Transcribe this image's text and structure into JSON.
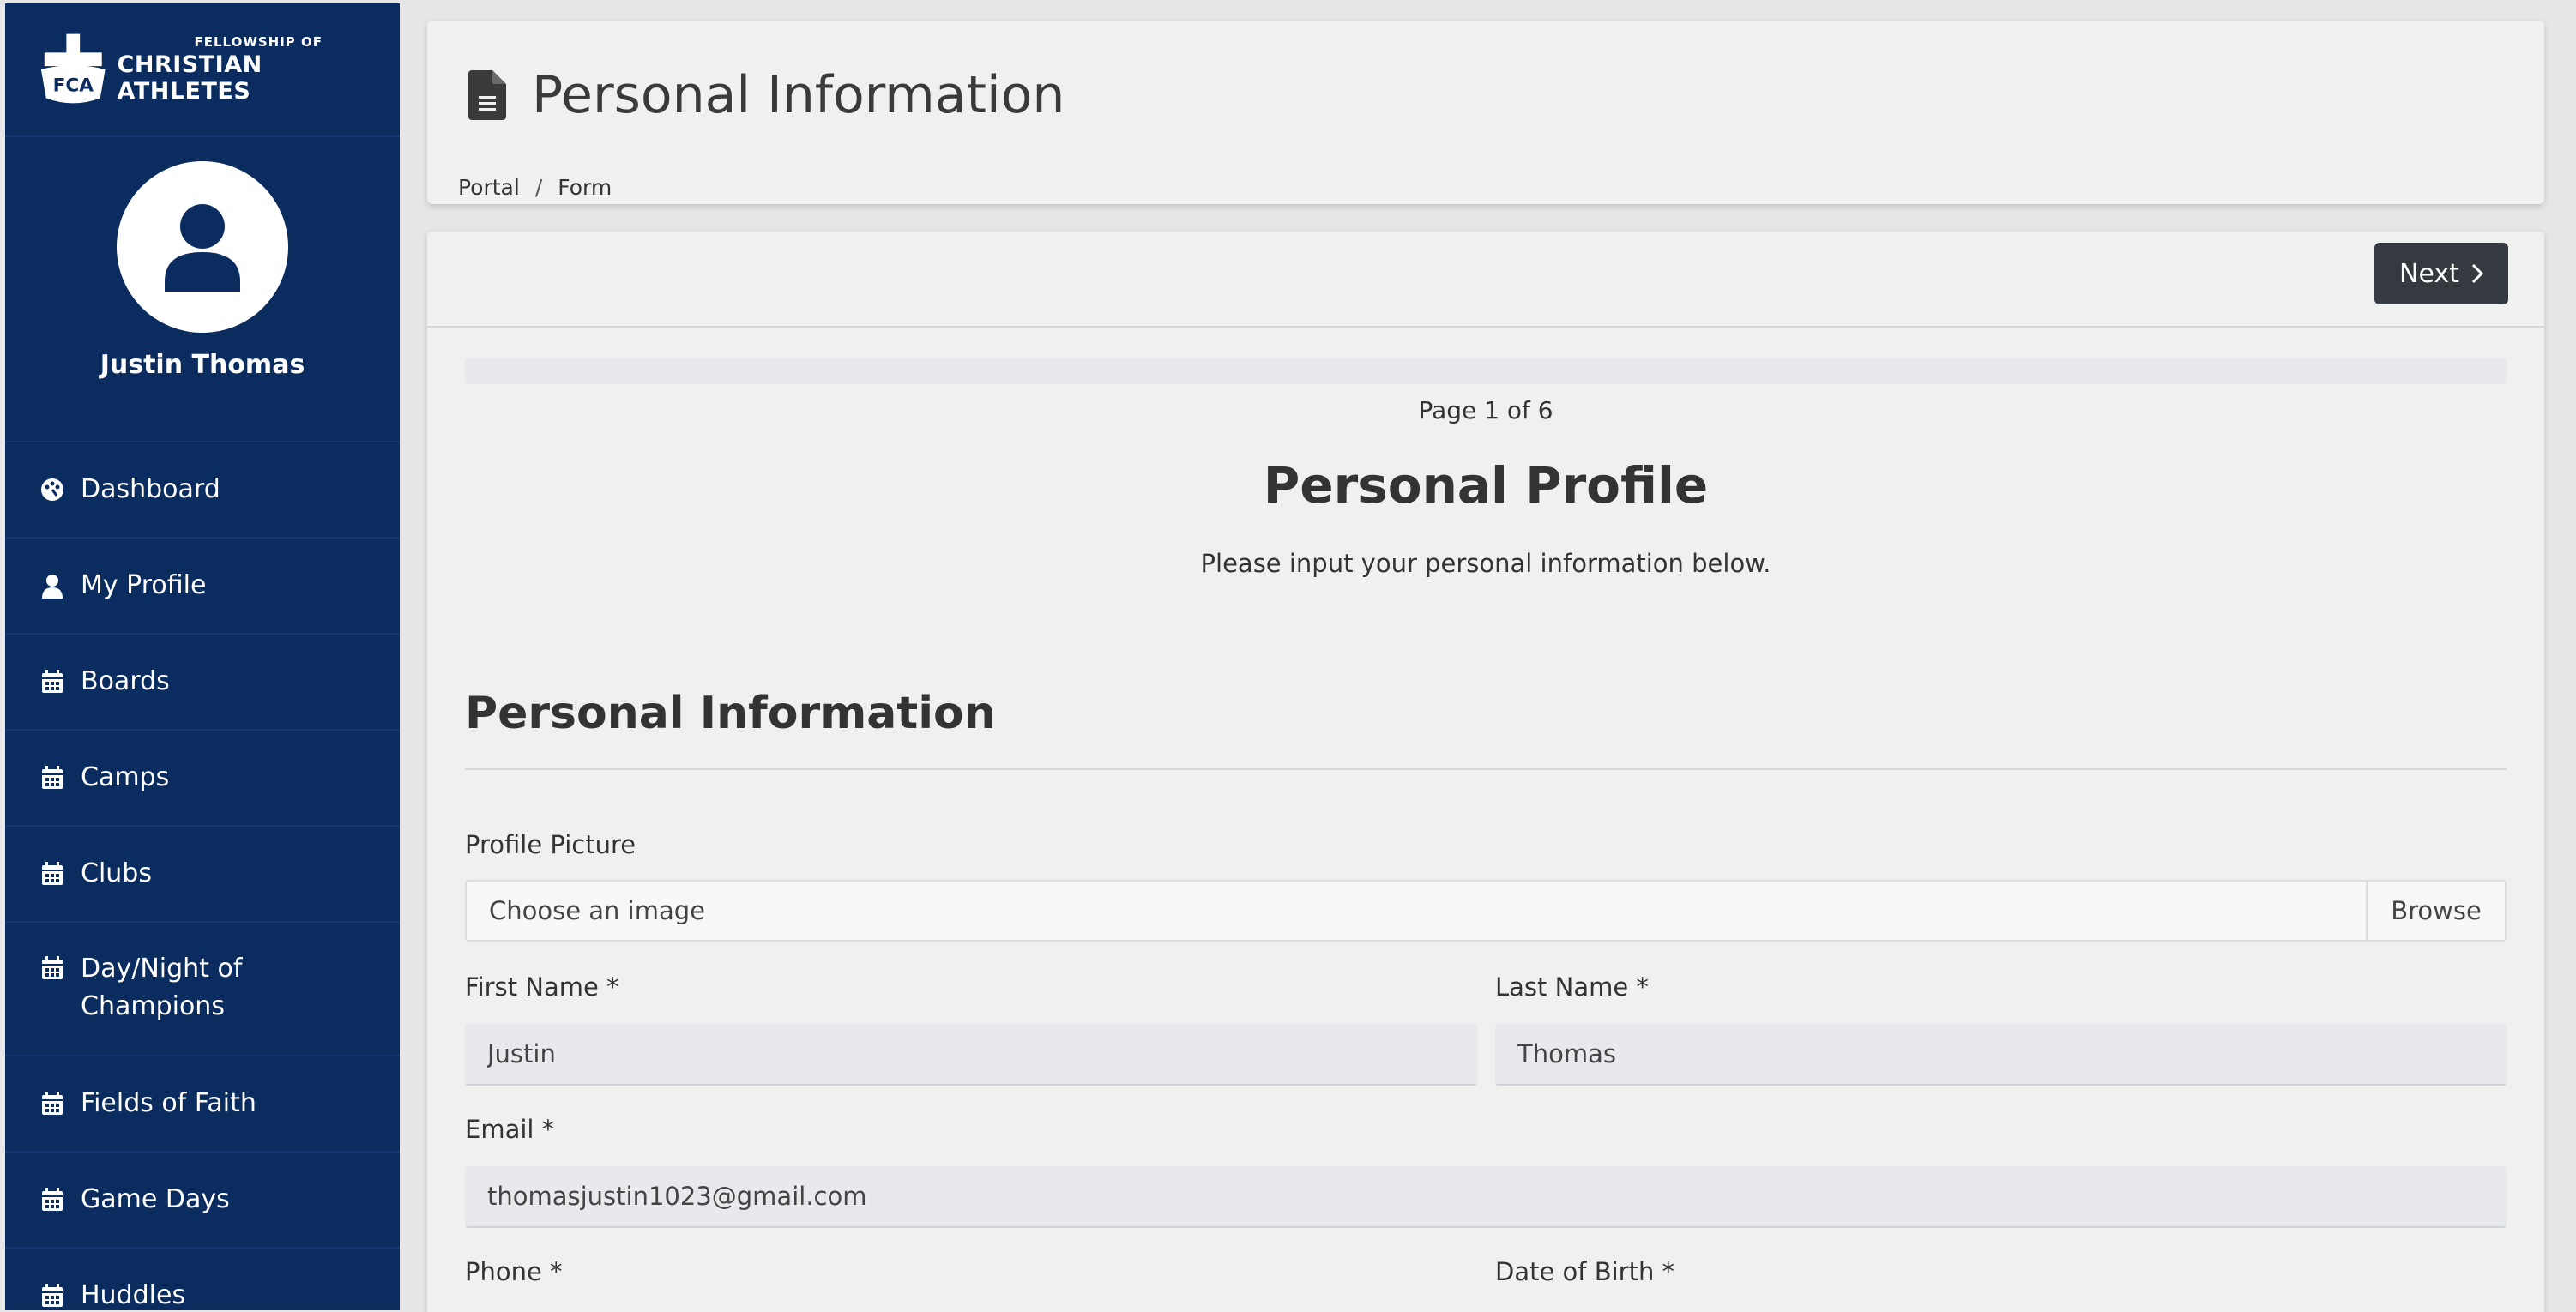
{
  "brand": {
    "logo_top": "FELLOWSHIP OF",
    "logo_bottom": "CHRISTIAN ATHLETES",
    "logo_mark": "FCA",
    "color_primary": "#0b2c5f"
  },
  "user": {
    "name": "Justin Thomas"
  },
  "sidebar": {
    "items": [
      {
        "label": "Dashboard",
        "icon": "palette-icon"
      },
      {
        "label": "My Profile",
        "icon": "user-icon"
      },
      {
        "label": "Boards",
        "icon": "calendar-icon"
      },
      {
        "label": "Camps",
        "icon": "calendar-icon"
      },
      {
        "label": "Clubs",
        "icon": "calendar-icon"
      },
      {
        "label": "Day/Night of Champions",
        "icon": "calendar-icon"
      },
      {
        "label": "Fields of Faith",
        "icon": "calendar-icon"
      },
      {
        "label": "Game Days",
        "icon": "calendar-icon"
      },
      {
        "label": "Huddles",
        "icon": "calendar-icon"
      }
    ]
  },
  "header": {
    "title": "Personal Information",
    "breadcrumb": [
      "Portal",
      "Form"
    ],
    "breadcrumb_sep": "/"
  },
  "form": {
    "next_label": "Next",
    "page_indicator": "Page 1 of 6",
    "title": "Personal Profile",
    "subtitle": "Please input your personal information below.",
    "section_title": "Personal Information",
    "profile_picture": {
      "label": "Profile Picture",
      "placeholder": "Choose an image",
      "browse_label": "Browse"
    },
    "first_name": {
      "label": "First Name *",
      "value": "Justin"
    },
    "last_name": {
      "label": "Last Name *",
      "value": "Thomas"
    },
    "email": {
      "label": "Email *",
      "value": "thomasjustin1023@gmail.com"
    },
    "phone": {
      "label": "Phone *"
    },
    "dob": {
      "label": "Date of Birth *"
    }
  }
}
